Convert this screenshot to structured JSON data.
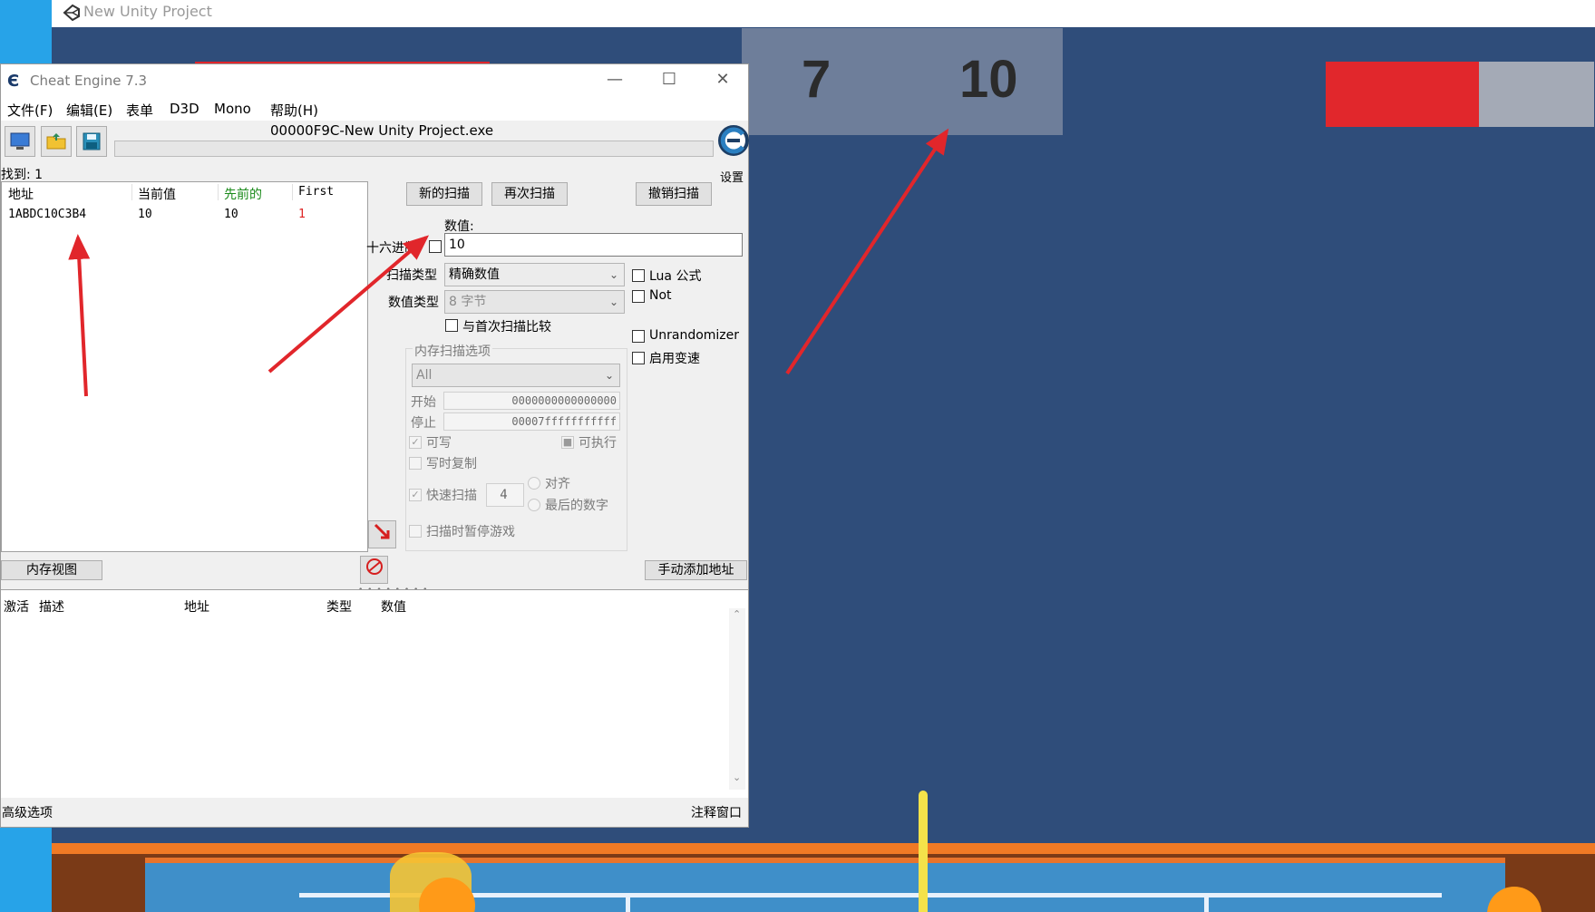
{
  "unity": {
    "title": "New Unity Project",
    "score_left": "7",
    "score_right": "10",
    "health_fraction": 0.57,
    "colors": {
      "health": "#e1272c",
      "background": "#2f4d7a",
      "court": "#3f8fc9"
    }
  },
  "ce": {
    "title": "Cheat Engine 7.3",
    "window_buttons": {
      "minimize": "—",
      "maximize": "☐",
      "close": "✕"
    },
    "menu": [
      "文件(F)",
      "编辑(E)",
      "表单",
      "D3D",
      "Mono",
      "帮助(H)"
    ],
    "process": "00000F9C-New Unity Project.exe",
    "settings_label": "设置",
    "found_label": "找到: 1",
    "results_headers": [
      "地址",
      "当前值",
      "先前的",
      "First"
    ],
    "results_rows": [
      {
        "address": "1ABDC10C3B4",
        "current": "10",
        "previous": "10",
        "first": "1"
      }
    ],
    "buttons": {
      "new_scan": "新的扫描",
      "next_scan": "再次扫描",
      "undo_scan": "撤销扫描",
      "memory_view": "内存视图",
      "add_address": "手动添加地址"
    },
    "value_label": "数值:",
    "hex_label": "十六进制",
    "value": "10",
    "scan_type_label": "扫描类型",
    "scan_type": "精确数值",
    "value_type_label": "数值类型",
    "value_type": "8 字节",
    "compare_first": "与首次扫描比较",
    "lua_formula": "Lua 公式",
    "not_label": "Not",
    "unrandomizer": "Unrandomizer",
    "speedhack": "启用变速",
    "mem_options": {
      "title": "内存扫描选项",
      "region": "All",
      "start_label": "开始",
      "start": "0000000000000000",
      "stop_label": "停止",
      "stop": "00007fffffffffff",
      "writable": "可写",
      "executable": "可执行",
      "copy_on_write": "写时复制",
      "fast_scan": "快速扫描",
      "fast_scan_value": "4",
      "align": "对齐",
      "last_digits": "最后的数字",
      "pause_game": "扫描时暂停游戏"
    },
    "address_list_headers": [
      "激活",
      "描述",
      "地址",
      "类型",
      "数值"
    ],
    "status_left": "高级选项",
    "status_right": "注释窗口"
  }
}
